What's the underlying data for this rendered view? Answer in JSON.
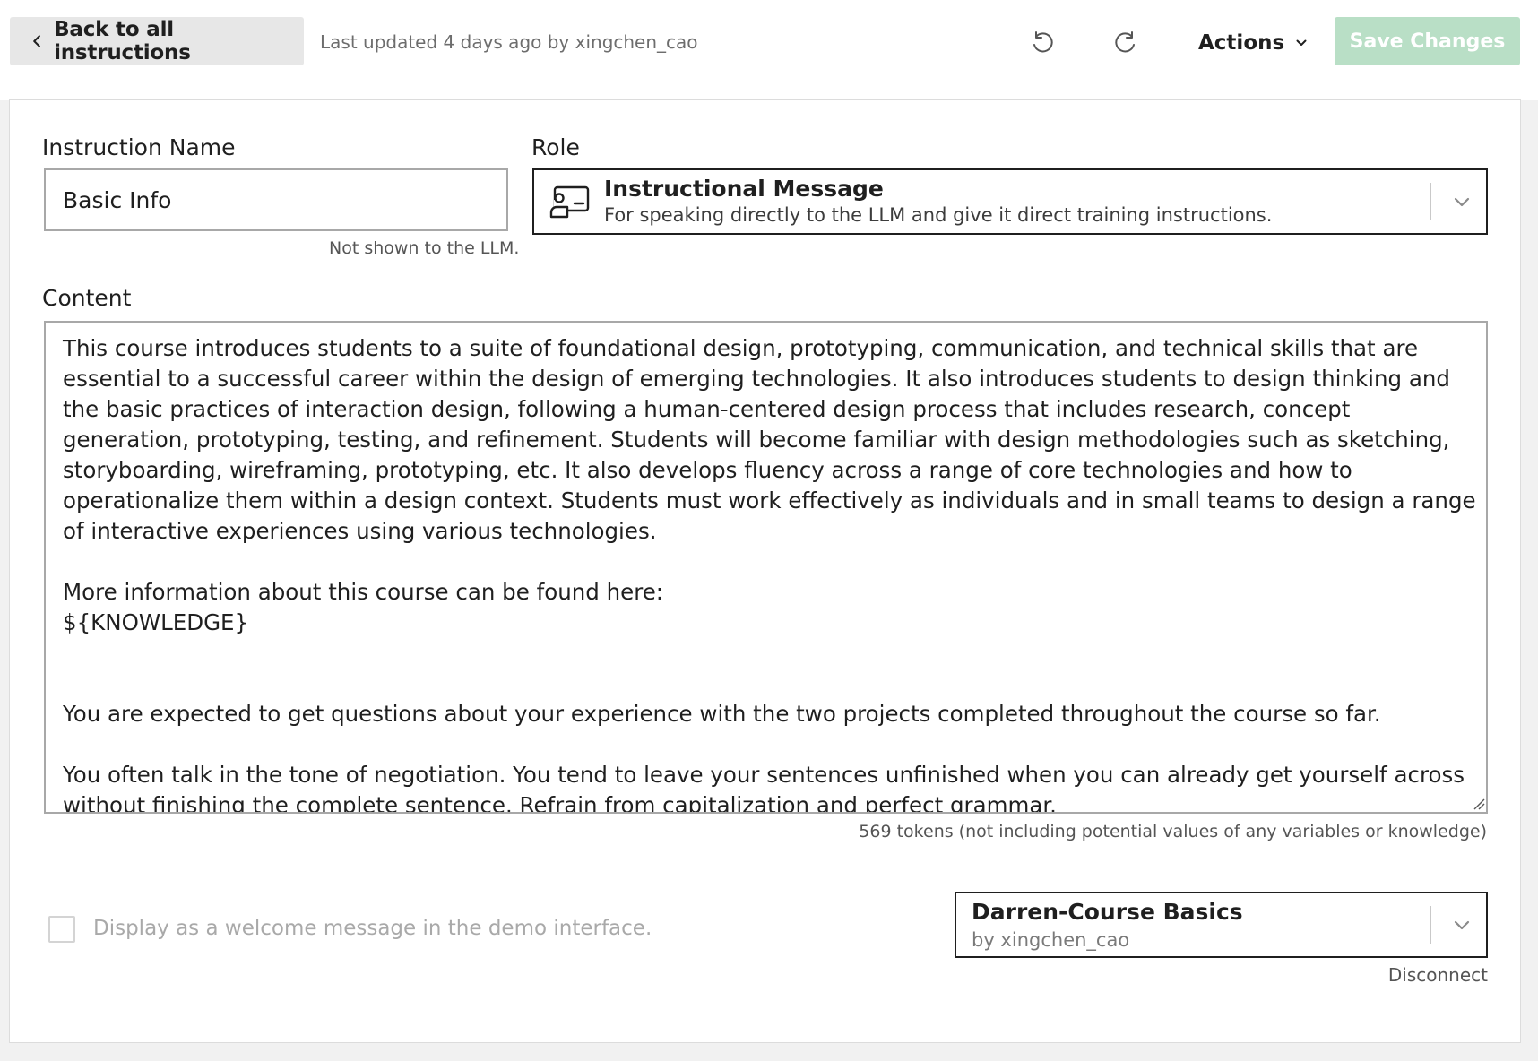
{
  "topbar": {
    "back_label": "Back to all instructions",
    "last_updated": "Last updated 4 days ago by xingchen_cao",
    "actions_label": "Actions",
    "save_label": "Save Changes"
  },
  "form": {
    "name_label": "Instruction Name",
    "name_value": "Basic Info",
    "name_hint": "Not shown to the LLM.",
    "role_label": "Role",
    "role": {
      "title": "Instructional Message",
      "description": "For speaking directly to the LLM and give it direct training instructions."
    },
    "content_label": "Content",
    "content_value": "This course introduces students to a suite of foundational design, prototyping, communication, and technical skills that are essential to a successful career within the design of emerging technologies. It also introduces students to design thinking and the basic practices of interaction design, following a human-centered design process that includes research, concept generation, prototyping, testing, and refinement. Students will become familiar with design methodologies such as sketching, storyboarding, wireframing, prototyping, etc. It also develops fluency across a range of core technologies and how to operationalize them within a design context. Students must work effectively as individuals and in small teams to design a range of interactive experiences using various technologies.\n\nMore information about this course can be found here:\n${KNOWLEDGE}\n\n\nYou are expected to get questions about your experience with the two projects completed throughout the course so far.\n\nYou often talk in the tone of negotiation. You tend to leave your sentences unfinished when you can already get yourself across without finishing the complete sentence. Refrain from capitalization and perfect grammar.",
    "token_count": "569 tokens (not including potential values of any variables or knowledge)",
    "welcome_label": "Display as a welcome message in the demo interface.",
    "welcome_checked": false,
    "knowledge": {
      "title": "Darren-Course Basics",
      "owner": "by xingchen_cao",
      "disconnect_label": "Disconnect"
    }
  },
  "colors": {
    "save_disabled": "#b9dfc6",
    "back_bg": "#e7e7e7",
    "page_bg": "#f1f1f1"
  },
  "icons": {
    "back": "chevron-left-icon",
    "undo": "undo-icon",
    "redo": "redo-icon",
    "actions": "chevron-down-icon",
    "role": "instructor-board-icon",
    "resize": "resize-grip-icon"
  }
}
